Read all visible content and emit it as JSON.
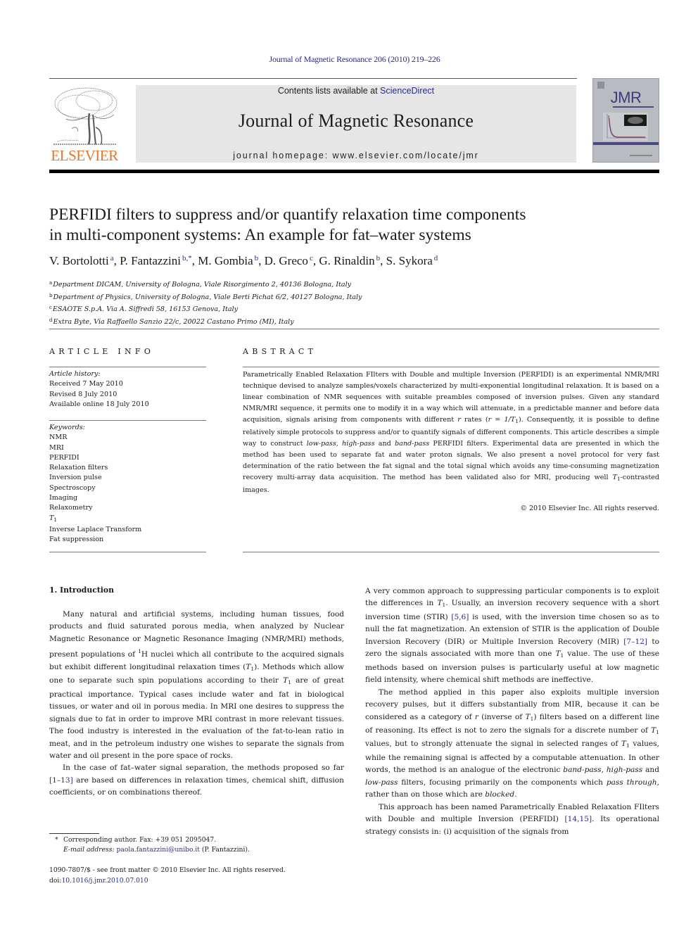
{
  "header": {
    "running_head": "Journal of Magnetic Resonance 206 (2010) 219–226",
    "publisher_wordmark": "ELSEVIER",
    "contents_prefix": "Contents lists available at ",
    "contents_link": "ScienceDirect",
    "journal_name": "Journal of Magnetic Resonance",
    "homepage": "journal homepage: www.elsevier.com/locate/jmr",
    "cover_title": "JMR",
    "colors": {
      "link": "#2a2a8c",
      "elsevier_orange": "#e6762b",
      "banner_bg": "#e6e6e6"
    }
  },
  "article": {
    "title_line1": "PERFIDI filters to suppress and/or quantify relaxation time components",
    "title_line2": "in multi-component systems: An example for fat–water systems",
    "authors": [
      {
        "name": "V. Bortolotti",
        "aff": "a"
      },
      {
        "name": "P. Fantazzini",
        "aff": "b,*"
      },
      {
        "name": "M. Gombia",
        "aff": "b"
      },
      {
        "name": "D. Greco",
        "aff": "c"
      },
      {
        "name": "G. Rinaldin",
        "aff": "b"
      },
      {
        "name": "S. Sykora",
        "aff": "d"
      }
    ],
    "affiliations": [
      {
        "mark": "a",
        "text": "Department DICAM, University of Bologna, Viale Risorgimento 2, 40136 Bologna, Italy"
      },
      {
        "mark": "b",
        "text": "Department of Physics, University of Bologna, Viale Berti Pichat 6/2, 40127 Bologna, Italy"
      },
      {
        "mark": "c",
        "text": "ESAOTE S.p.A. Via A. Siffredi 58, 16153 Genova, Italy"
      },
      {
        "mark": "d",
        "text": "Extra Byte, Via Raffaello Sanzio 22/c, 20022 Castano Primo (MI), Italy"
      }
    ]
  },
  "article_info": {
    "heading": "ARTICLE INFO",
    "history_label": "Article history:",
    "history": [
      "Received 7 May 2010",
      "Revised 8 July 2010",
      "Available online 18 July 2010"
    ],
    "keywords_label": "Keywords:",
    "keywords": [
      "NMR",
      "MRI",
      "PERFIDI",
      "Relaxation filters",
      "Inversion pulse",
      "Spectroscopy",
      "Imaging",
      "Relaxometry",
      "T1",
      "Inverse Laplace Transform",
      "Fat suppression"
    ]
  },
  "abstract": {
    "heading": "ABSTRACT",
    "p1": "Parametrically Enabled Relaxation FIlters with Double and multiple Inversion (PERFIDI) is an experimental NMR/MRI technique devised to analyze samples/voxels characterized by multi-exponential longitudinal relaxation. It is based on a linear combination of NMR sequences with suitable preambles composed of inversion pulses. Given any standard NMR/MRI sequence, it permits one to modify it in a way which will attenuate, in a predictable manner and before data acquisition, signals arising from components with different ",
    "r": "r",
    "p2": " rates (",
    "r_formula": "r = 1/T",
    "p3": "). Consequently, it is possible to define relatively simple protocols to suppress and/or to quantify signals of different components. This article describes a simple way to construct ",
    "low_pass": "low-pass",
    "sep1": ", ",
    "high_pass": "high-pass",
    "sep2": " and ",
    "band_pass": "band-pass",
    "p4": " PERFIDI filters. Experimental data are presented in which the method has been used to separate fat and water proton signals. We also present a novel protocol for very fast determination of the ratio between the fat signal and the total signal which avoids any time-consuming magnetization recovery multi-array data acquisition. The method has been validated also for MRI, producing well ",
    "t1": "T",
    "p5": "-contrasted images.",
    "copyright": "© 2010 Elsevier Inc. All rights reserved."
  },
  "body": {
    "section_heading": "1. Introduction",
    "left_p1a": "Many natural and artificial systems, including human tissues, food products and fluid saturated porous media, when analyzed by Nuclear Magnetic Resonance or Magnetic Resonance Imaging (NMR/MRI) methods, present populations of ",
    "left_p1_sup": "1",
    "left_p1b": "H nuclei which all contribute to the acquired signals but exhibit different longitudinal relaxation times (",
    "left_p1c": "). Methods which allow one to separate such spin populations according to their ",
    "left_p1d": " are of great practical importance. Typical cases include water and fat in biological tissues, or water and oil in porous media. In MRI one desires to suppress the signals due to fat in order to improve MRI contrast in more relevant tissues. The food industry is interested in the evaluation of the fat-to-lean ratio in meat, and in the petroleum industry one wishes to separate the signals from water and oil present in the pore space of rocks.",
    "left_p2a": "In the case of fat–water signal separation, the methods proposed so far ",
    "left_p2_ref": "[1–13]",
    "left_p2b": " are based on differences in relaxation times, chemical shift, diffusion coefficients, or on combinations thereof.",
    "right_p1a": "A very common approach to suppressing particular components is to exploit the differences in ",
    "right_p1b": ". Usually, an inversion recovery sequence with a short inversion time (STIR) ",
    "right_p1_ref1": "[5,6]",
    "right_p1c": " is used, with the inversion time chosen so as to null the fat magnetization. An extension of STIR is the application of Double Inversion Recovery (DIR) or Multiple Inversion Recovery (MIR) ",
    "right_p1_ref2": "[7–12]",
    "right_p1d": " to zero the signals associated with more than one ",
    "right_p1e": " value. The use of these methods based on inversion pulses is particularly useful at low magnetic field intensity, where chemical shift methods are ineffective.",
    "right_p2a": "The method applied in this paper also exploits multiple inversion recovery pulses, but it differs substantially from MIR, because it can be considered as a category of ",
    "right_p2_r": "r",
    "right_p2b": " (inverse of ",
    "right_p2c": ") filters based on a different line of reasoning. Its effect is not to zero the signals for a discrete number of ",
    "right_p2d": " values, but to strongly attenuate the signal in selected ranges of ",
    "right_p2e": " values, while the remaining signal is affected by a computable attenuation. In other words, the method is an analogue of the electronic ",
    "right_p2_band": "band-pass",
    "right_p2_sep1": ", ",
    "right_p2_high": "high-pass",
    "right_p2_sep2": " and ",
    "right_p2_low": "low-pass",
    "right_p2f": " filters, focusing primarily on the components which ",
    "right_p2_pass": "pass through",
    "right_p2g": ", rather than on those which are ",
    "right_p2_blocked": "blocked",
    "right_p2h": ".",
    "right_p3a": "This approach has been named Parametrically Enabled Relaxation FIlters with Double and multiple Inversion (PERFIDI) ",
    "right_p3_ref": "[14,15]",
    "right_p3b": ". Its operational strategy consists in: (i) acquisition of the signals from",
    "t1_letter": "T",
    "t1_sub": "1"
  },
  "footnotes": {
    "star": "*",
    "corresponding": "Corresponding author. Fax: +39 051 2095047.",
    "email_label": "E-mail address:",
    "email": "paola.fantazzini@unibo.it",
    "email_suffix": " (P. Fantazzini).",
    "issn_line": "1090-7807/$ - see front matter © 2010 Elsevier Inc. All rights reserved.",
    "doi_prefix": "doi:",
    "doi": "10.1016/j.jmr.2010.07.010"
  }
}
